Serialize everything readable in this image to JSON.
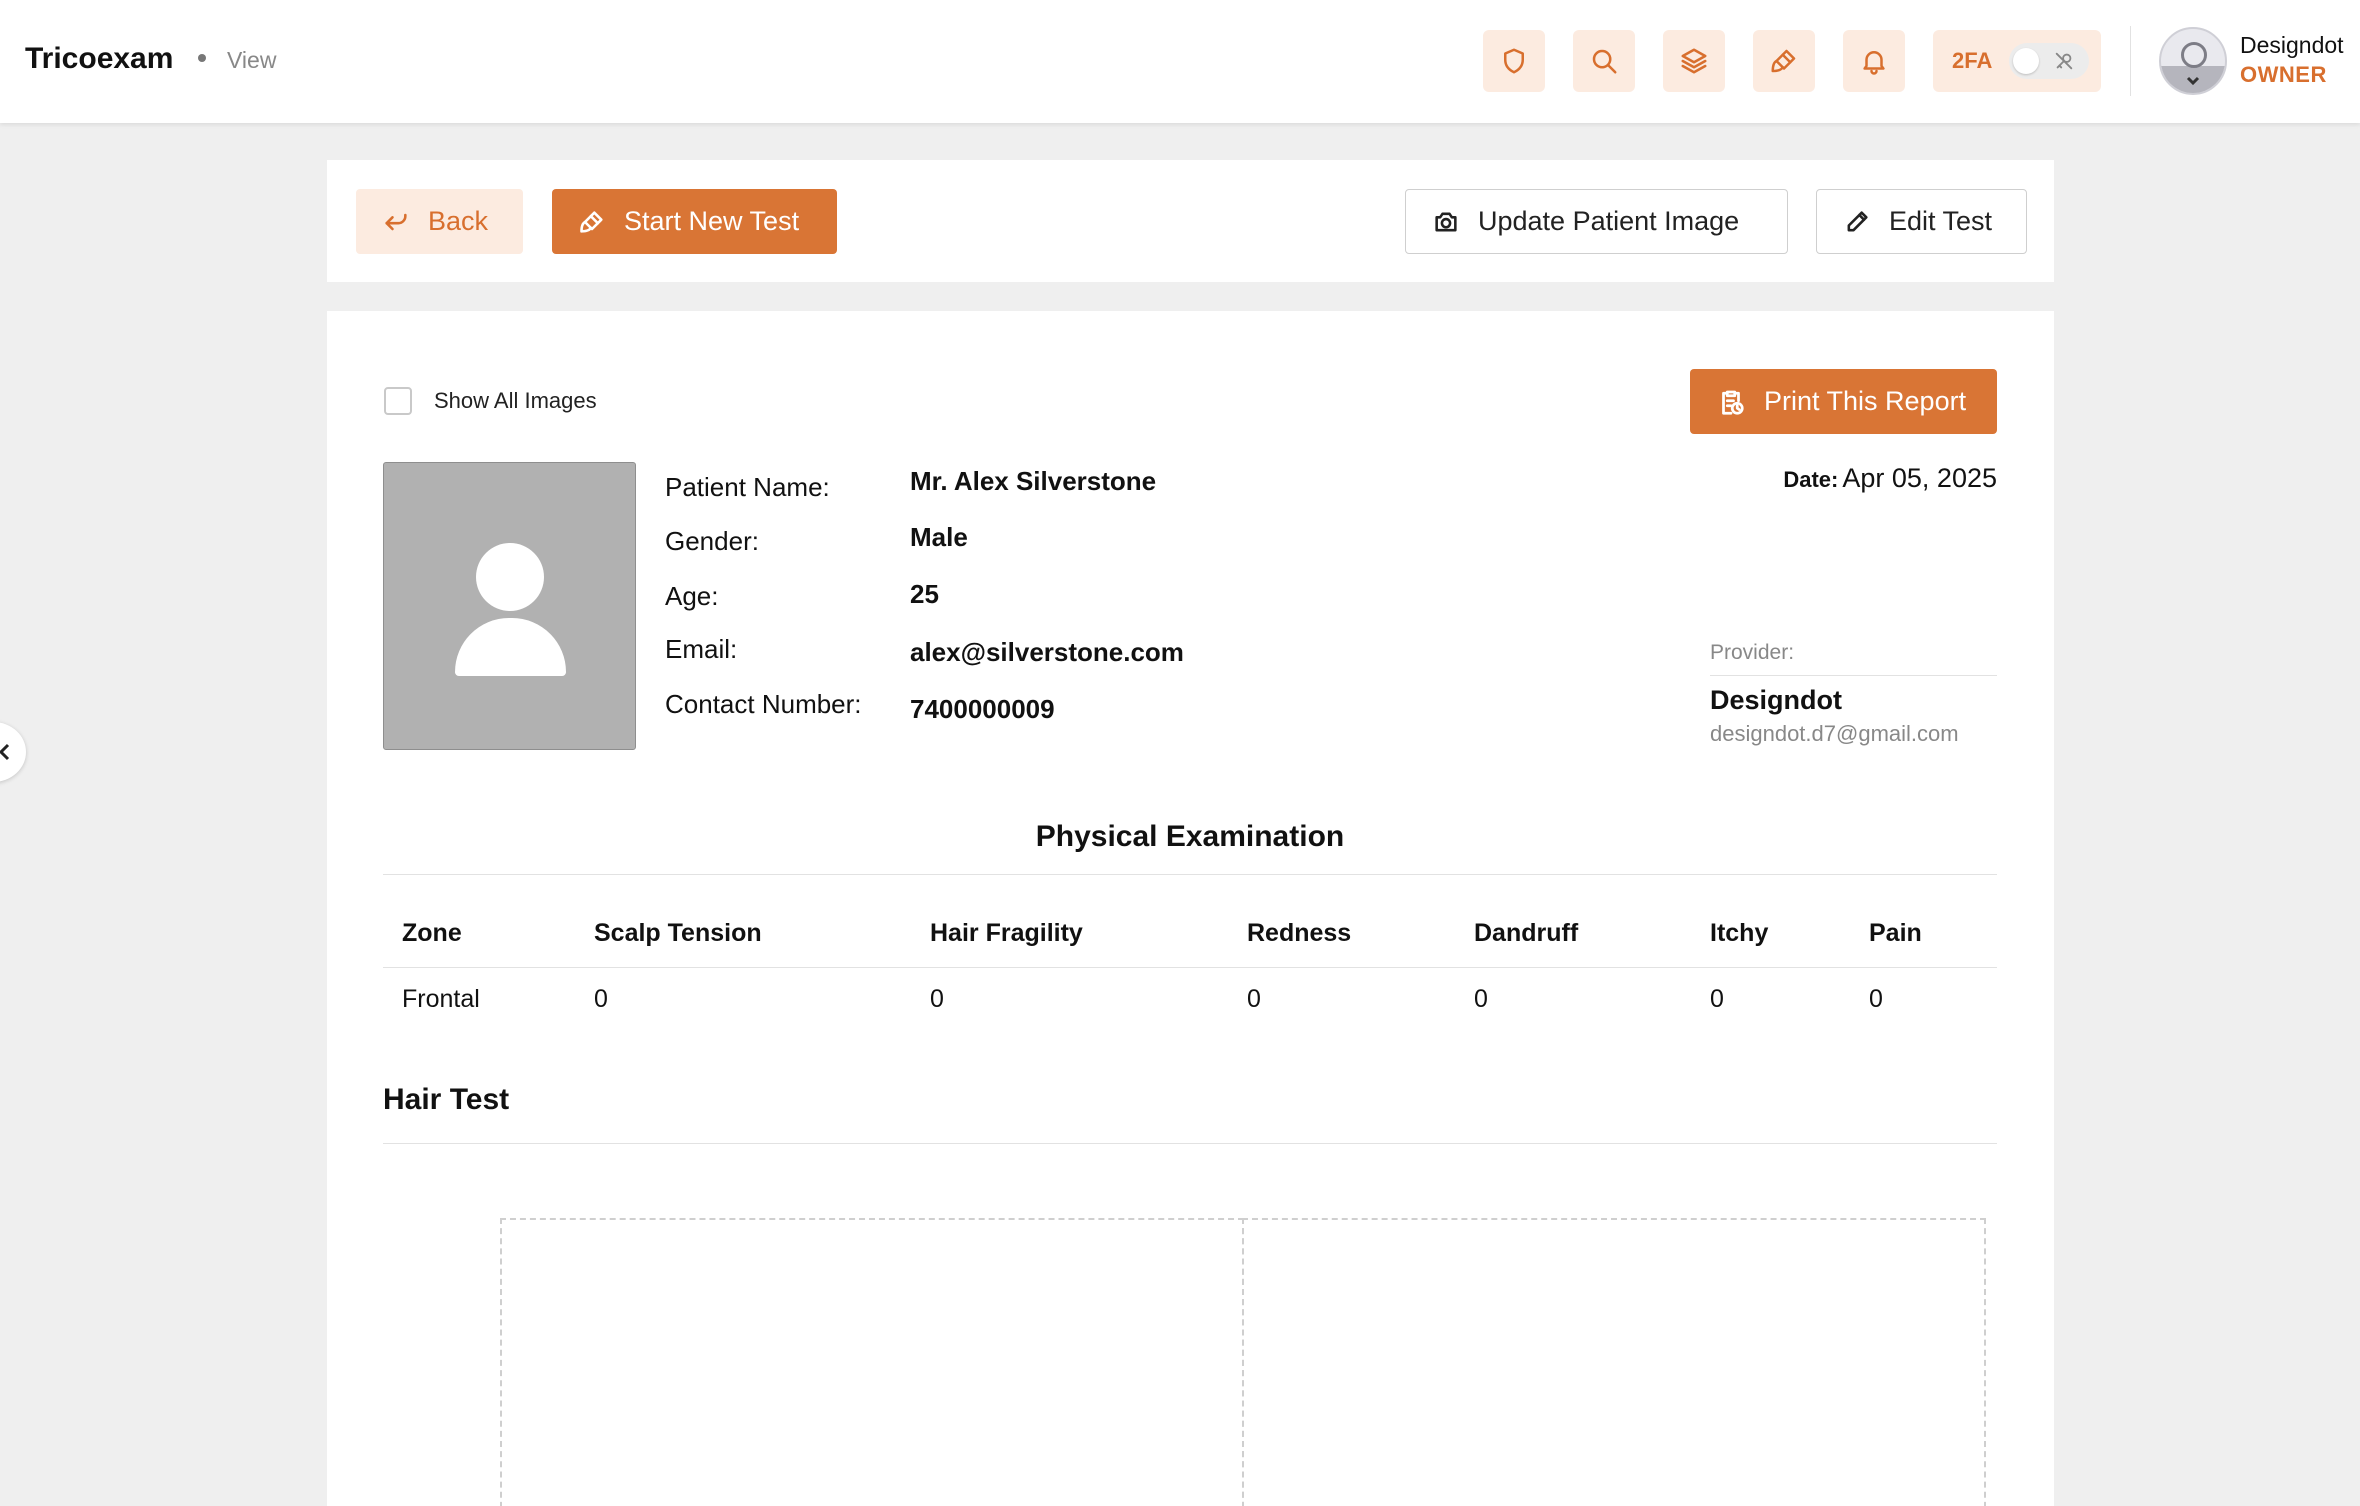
{
  "header": {
    "brand": "Tricoexam",
    "breadcrumb": "View",
    "twofa_label": "2FA",
    "user": {
      "name": "Designdot",
      "role": "OWNER"
    },
    "icons": [
      "shield-icon",
      "search-icon",
      "layers-icon",
      "brush-icon",
      "bell-icon"
    ]
  },
  "actions": {
    "back": "Back",
    "start_new_test": "Start New Test",
    "update_patient_image": "Update Patient Image",
    "edit_test": "Edit Test"
  },
  "report": {
    "show_all_images": "Show All Images",
    "print": "Print This Report",
    "patient": {
      "name_label": "Patient Name:",
      "name": "Mr. Alex Silverstone",
      "gender_label": "Gender:",
      "gender": "Male",
      "age_label": "Age:",
      "age": "25",
      "email_label": "Email:",
      "email": "alex@silverstone.com",
      "contact_label": "Contact Number:",
      "contact": "7400000009"
    },
    "date_label": "Date:",
    "date": "Apr 05, 2025",
    "provider_label": "Provider:",
    "provider_name": "Designdot",
    "provider_email": "designdot.d7@gmail.com",
    "physical_exam_title": "Physical Examination",
    "table": {
      "headers": [
        "Zone",
        "Scalp Tension",
        "Hair Fragility",
        "Redness",
        "Dandruff",
        "Itchy",
        "Pain"
      ],
      "rows": [
        [
          "Frontal",
          "0",
          "0",
          "0",
          "0",
          "0",
          "0"
        ]
      ]
    },
    "hair_test_title": "Hair Test"
  },
  "colors": {
    "accent": "#d97535",
    "accent_light": "#fcebe0",
    "background": "#efefef"
  }
}
